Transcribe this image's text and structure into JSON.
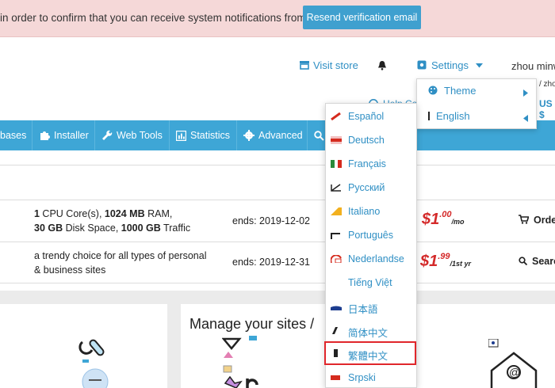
{
  "notice": {
    "text": "in order to confirm that you can receive system notifications from us.",
    "button": "Resend verification email"
  },
  "header": {
    "visit_store": "Visit store",
    "settings": "Settings",
    "user": "zhou minw",
    "user_sub": "/ zhou",
    "help": "Help Ce",
    "region": "US $"
  },
  "nav": {
    "items": [
      "bases",
      "Installer",
      "Web Tools",
      "Statistics",
      "Advanced"
    ]
  },
  "rows": [
    {
      "desc_line1_a": "1",
      "desc_line1_b": " CPU Core(s), ",
      "desc_line1_c": "1024 MB",
      "desc_line1_d": " RAM,",
      "desc_line2_a": "30 GB",
      "desc_line2_b": " Disk Space, ",
      "desc_line2_c": "1000 GB",
      "desc_line2_d": " Traffic",
      "ends": "ends: 2019-12-02",
      "price_main": "$1",
      "price_sup": ".00",
      "price_per": "/mo",
      "action": "Orde"
    },
    {
      "desc_line1": "a trendy choice for all types of personal",
      "desc_line2": "& business sites",
      "ends": "ends: 2019-12-31",
      "price_main": "$1",
      "price_sup": ".99",
      "price_per": "/1st yr",
      "action": "Searc"
    }
  ],
  "manage_title": "Manage your sites /",
  "settings_menu": {
    "theme": "Theme",
    "language": "English"
  },
  "languages": [
    {
      "label": "Español",
      "flag_color": "#d52b1e"
    },
    {
      "label": "Deutsch",
      "flag_color": "#d52b1e"
    },
    {
      "label": "Français",
      "flag_color": "#2a8a3a"
    },
    {
      "label": "Русский",
      "flag_color": "#222222"
    },
    {
      "label": "Italiano",
      "flag_color": "#f2b01e"
    },
    {
      "label": "Português",
      "flag_color": "#222222"
    },
    {
      "label": "Nederlandse",
      "flag_color": "#d52b1e"
    },
    {
      "label": "Tiếng Việt",
      "flag_color": "#ffffff"
    },
    {
      "label": "日本語",
      "flag_color": "#1d3d8f"
    },
    {
      "label": "简体中文",
      "flag_color": "#222222"
    },
    {
      "label": "繁體中文",
      "flag_color": "#222222"
    },
    {
      "label": "Srpski",
      "flag_color": "#d52b1e"
    }
  ],
  "selected_language_index": 10,
  "colors": {
    "accent": "#3ea6d6",
    "link": "#2f8fc4",
    "price": "#d42a2a",
    "notice_bg": "#f5d8d8",
    "highlight_box": "#e0262b"
  }
}
